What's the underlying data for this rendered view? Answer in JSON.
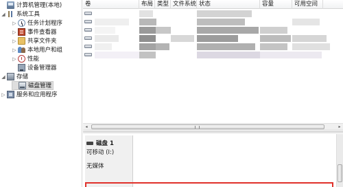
{
  "tree": {
    "items": [
      {
        "label": "计算机管理(本地)",
        "icon": "computer-management-icon",
        "expander": "",
        "selected": false
      },
      {
        "label": "系统工具",
        "icon": "system-tools-icon",
        "expander": "◢",
        "selected": false
      },
      {
        "label": "任务计划程序",
        "icon": "task-scheduler-icon",
        "expander": "▷",
        "selected": false
      },
      {
        "label": "事件查看器",
        "icon": "event-viewer-icon",
        "expander": "▷",
        "selected": false
      },
      {
        "label": "共享文件夹",
        "icon": "shared-folder-icon",
        "expander": "▷",
        "selected": false
      },
      {
        "label": "本地用户和组",
        "icon": "local-users-icon",
        "expander": "▷",
        "selected": false
      },
      {
        "label": "性能",
        "icon": "performance-icon",
        "expander": "▷",
        "selected": false
      },
      {
        "label": "设备管理器",
        "icon": "device-manager-icon",
        "expander": "",
        "selected": false
      },
      {
        "label": "存储",
        "icon": "storage-icon",
        "expander": "◢",
        "selected": false
      },
      {
        "label": "磁盘管理",
        "icon": "disk-icon",
        "expander": "",
        "selected": true
      },
      {
        "label": "服务和应用程序",
        "icon": "services-icon",
        "expander": "▷",
        "selected": false
      }
    ]
  },
  "volume_list": {
    "columns": [
      "卷",
      "布局",
      "类型",
      "文件系统",
      "状态",
      "容量",
      "可用空间"
    ],
    "row_count_label": "",
    "colors": {
      "blur_light": "#f2f2f2",
      "blur_mid": "#d9d9d9",
      "blur_dark": "#8a8a8a"
    }
  },
  "horizontal_scroll": {
    "left_arrow": "◂",
    "right_arrow": "▸"
  },
  "disk": {
    "title": "磁盘 1",
    "type": "可移动 (I:)",
    "media": "无媒体"
  },
  "colors": {
    "highlight": "#e0302a",
    "selected_bg": "#dedede"
  }
}
